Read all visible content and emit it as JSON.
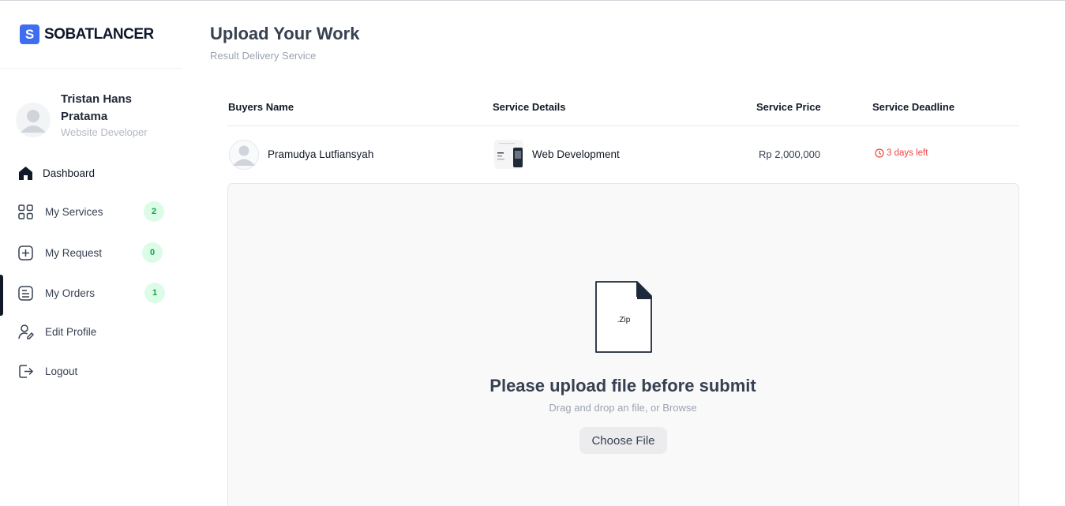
{
  "brand": {
    "logo_glyph": "S",
    "name": "SOBATLANCER",
    "color": "#3f6df2"
  },
  "user": {
    "name": "Tristan Hans Pratama",
    "role": "Website Developer"
  },
  "nav": {
    "dashboard": {
      "label": "Dashboard",
      "icon": "home-icon"
    },
    "services": {
      "label": "My Services",
      "badge": "2",
      "icon": "grid-icon"
    },
    "request": {
      "label": "My Request",
      "badge": "0",
      "icon": "plus-square-icon"
    },
    "orders": {
      "label": "My Orders",
      "badge": "1",
      "icon": "document-icon"
    },
    "edit_profile": {
      "label": "Edit Profile",
      "icon": "user-edit-icon"
    },
    "logout": {
      "label": "Logout",
      "icon": "logout-icon"
    }
  },
  "page": {
    "title": "Upload Your Work",
    "subtitle": "Result Delivery Service"
  },
  "table": {
    "headers": {
      "buyer": "Buyers Name",
      "details": "Service Details",
      "price": "Service Price",
      "deadline": "Service Deadline"
    },
    "row": {
      "buyer": "Pramudya Lutfiansyah",
      "service": "Web Development",
      "price": "Rp 2,000,000",
      "deadline": "3 days left"
    }
  },
  "upload": {
    "file_type": ".Zip",
    "title": "Please upload file before submit",
    "hint": "Drag and drop an file, or Browse",
    "button": "Choose File"
  },
  "colors": {
    "badge_bg": "#dcfce7",
    "badge_text": "#16a34a",
    "deadline": "#ef4444"
  }
}
